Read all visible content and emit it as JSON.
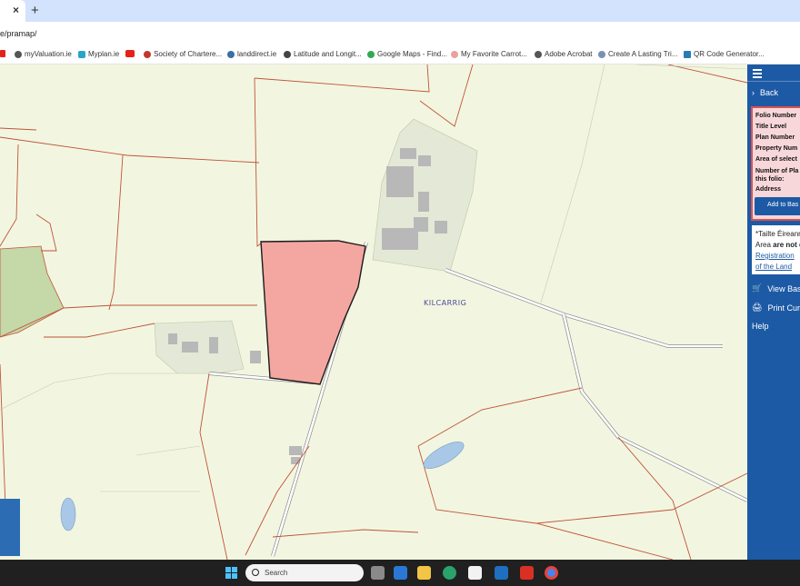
{
  "browser": {
    "tab_close": "×",
    "new_tab": "+",
    "url": "e/pramap/"
  },
  "bookmarks": [
    {
      "label": "myValuation.ie",
      "color": "#555555"
    },
    {
      "label": "Myplan.ie",
      "color": "#2aa3c9"
    },
    {
      "label": "Society of Chartere...",
      "color": "#c0392b"
    },
    {
      "label": "landdirect.ie",
      "color": "#3b6ea8"
    },
    {
      "label": "Latitude and Longit...",
      "color": "#444444"
    },
    {
      "label": "Google Maps - Find...",
      "color": "#34a853"
    },
    {
      "label": "My Favorite Carrot...",
      "color": "#e8a0a0"
    },
    {
      "label": "Adobe Acrobat",
      "color": "#555555"
    },
    {
      "label": "Create A Lasting Tri...",
      "color": "#7a8fb8"
    },
    {
      "label": "QR Code Generator...",
      "color": "#2a7ab8"
    }
  ],
  "map": {
    "townland_label": "KILCARRIG",
    "parcel_color": "#f4a7a0",
    "boundary_color": "#c0533a"
  },
  "panel": {
    "back_label": "Back",
    "info": {
      "folio_number": "Folio Number",
      "title_level": "Title Level",
      "plan_number": "Plan Number",
      "property_number": "Property Num",
      "area_selected": "Area of select",
      "number_of_plans_1": "Number of Pla",
      "number_of_plans_2": "this folio:",
      "address": "Address"
    },
    "add_to_basket": "Add to Bas",
    "notice": {
      "line1": "*Tailte Éireann",
      "line2_prefix": "Area ",
      "line2_bold": "are not c",
      "link1": "Registration",
      "link2": "of the Land"
    },
    "view_basket": "View Bask",
    "print_current": "Print Curr",
    "help": "Help"
  },
  "taskbar": {
    "search_placeholder": "Search"
  }
}
